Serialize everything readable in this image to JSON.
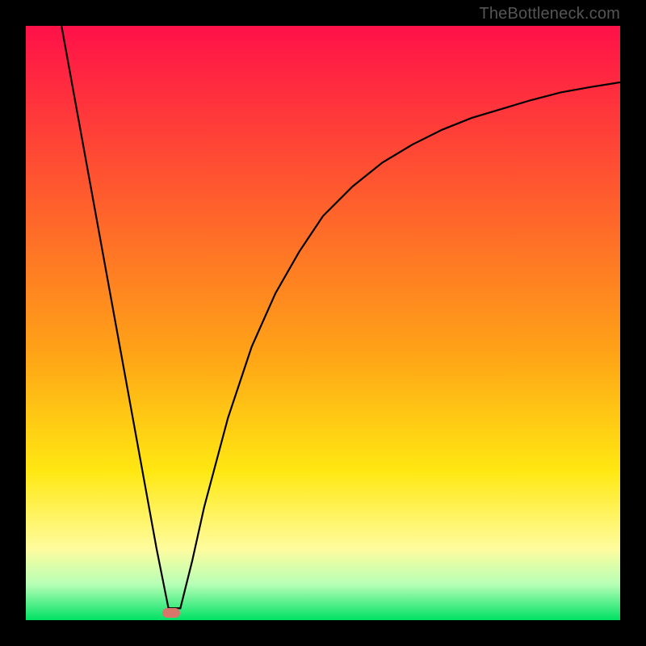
{
  "watermark": "TheBottleneck.com",
  "colors": {
    "top": "#ff1149",
    "mid_red": "#ff5a2e",
    "orange": "#ffa317",
    "yellow": "#ffe812",
    "pale_yellow": "#fffc9e",
    "pale_green": "#b6ffb6",
    "green": "#00e164",
    "curve": "#000000",
    "marker": "#d9766b",
    "frame": "#000000"
  },
  "chart_data": {
    "type": "line",
    "title": "",
    "xlabel": "",
    "ylabel": "",
    "xlim": [
      0,
      100
    ],
    "ylim": [
      0,
      100
    ],
    "gradient_stops": [
      {
        "offset": 0.0,
        "color": "#ff1149"
      },
      {
        "offset": 0.28,
        "color": "#ff5a2e"
      },
      {
        "offset": 0.55,
        "color": "#ffa317"
      },
      {
        "offset": 0.75,
        "color": "#ffe812"
      },
      {
        "offset": 0.88,
        "color": "#fffc9e"
      },
      {
        "offset": 0.94,
        "color": "#b6ffb6"
      },
      {
        "offset": 1.0,
        "color": "#00e164"
      }
    ],
    "series": [
      {
        "name": "bottleneck-curve",
        "x": [
          6,
          10,
          14,
          18,
          22,
          24,
          26,
          28,
          30,
          34,
          38,
          42,
          46,
          50,
          55,
          60,
          65,
          70,
          75,
          80,
          85,
          90,
          95,
          100
        ],
        "y": [
          100,
          78,
          56,
          34,
          12,
          2,
          2,
          10,
          19,
          34,
          46,
          55,
          62,
          68,
          73,
          77,
          80,
          82.5,
          84.5,
          86,
          87.5,
          88.8,
          89.7,
          90.5
        ]
      }
    ],
    "marker": {
      "x": 24.5,
      "y": 1.2
    }
  }
}
